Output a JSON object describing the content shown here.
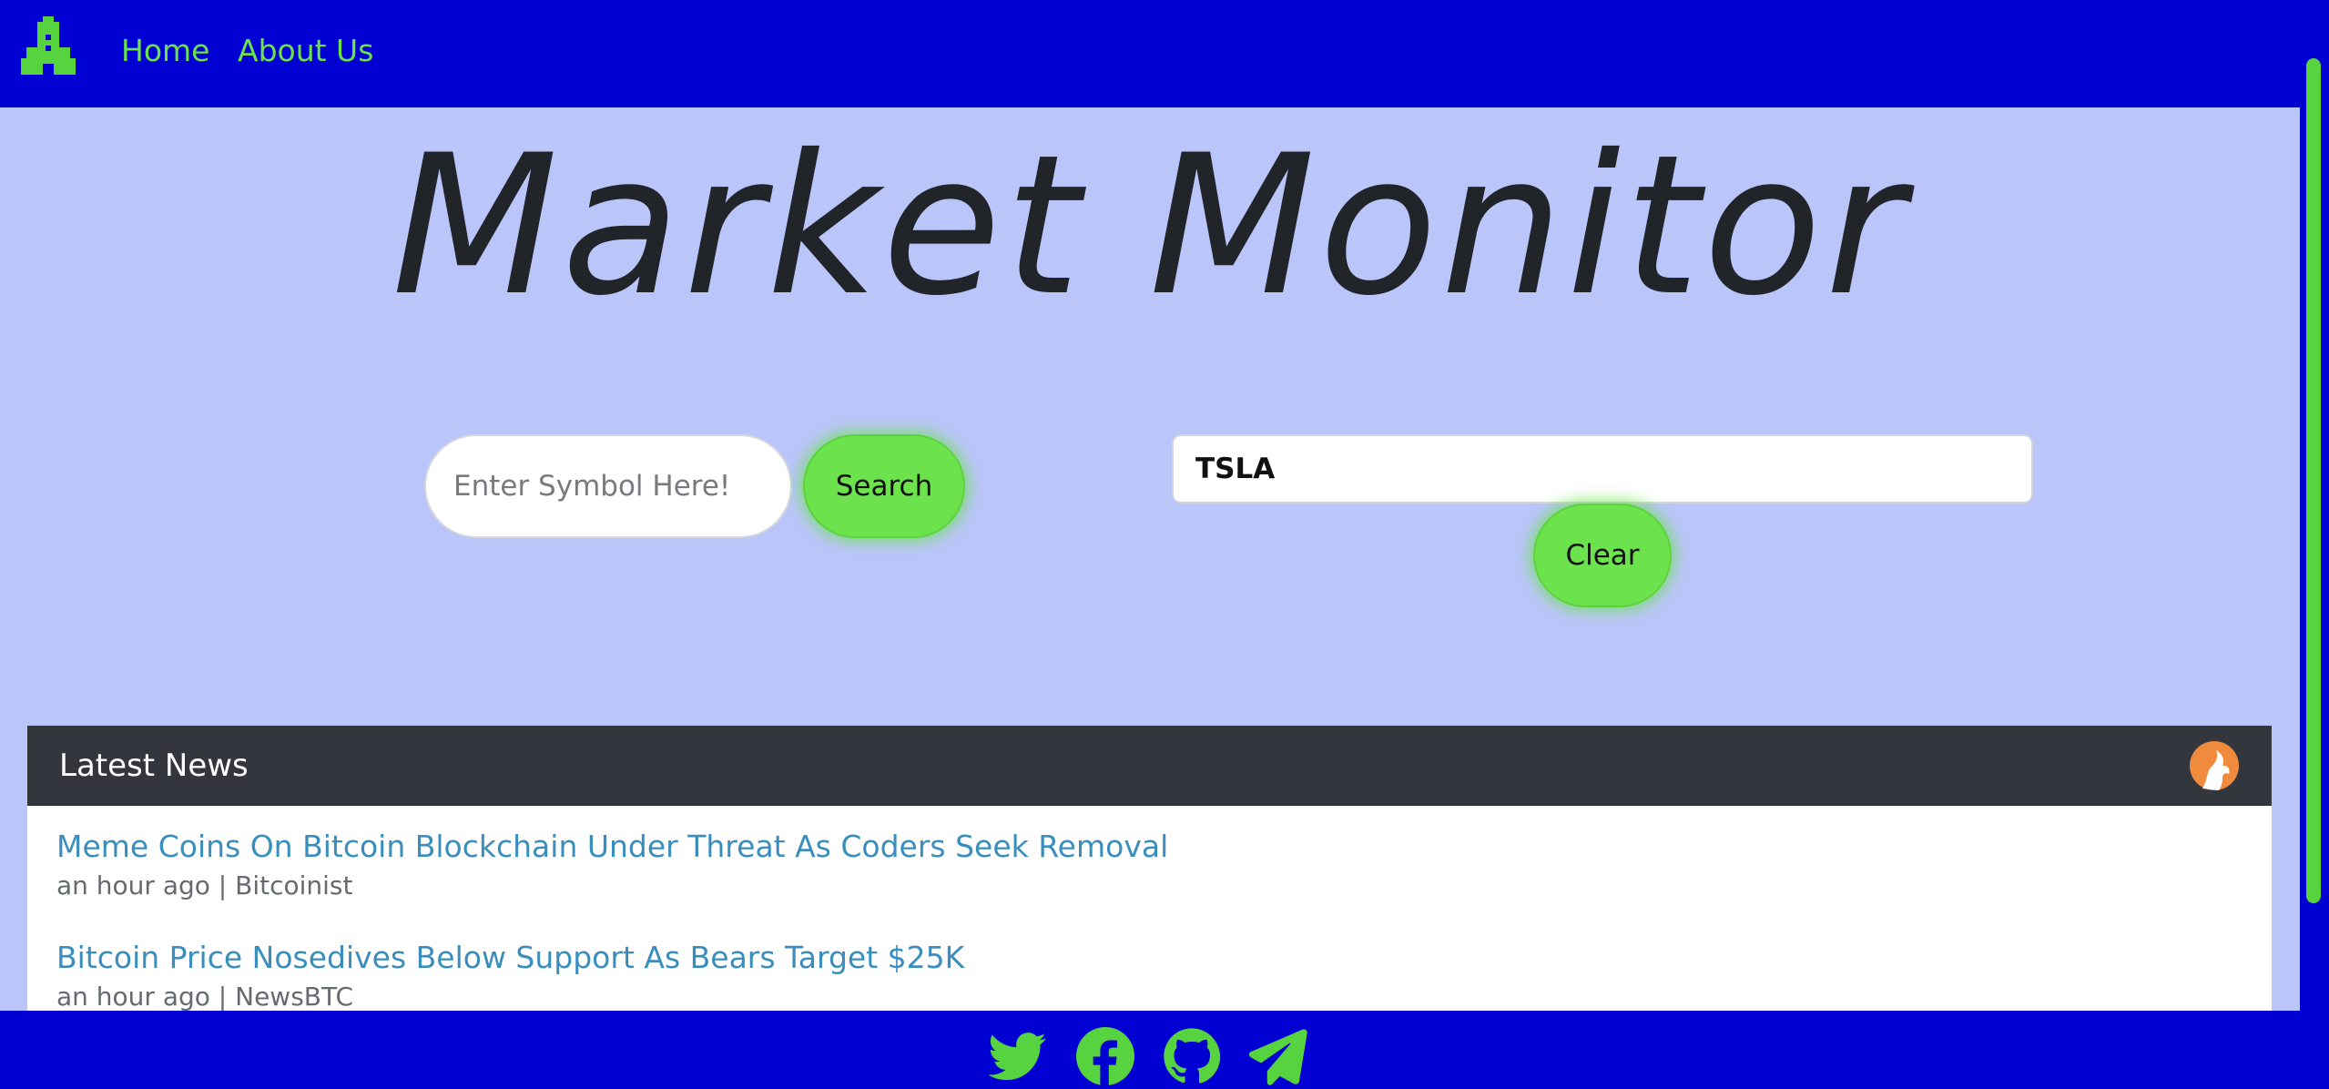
{
  "colors": {
    "navbar_background": "#0000d2",
    "page_background": "#bac5fa",
    "accent_green": "#6ce24c",
    "news_header_background": "#33363d",
    "news_link": "#3a8ebd"
  },
  "navbar": {
    "logo_icon": "pixel-rocket-icon",
    "links": [
      {
        "label": "Home"
      },
      {
        "label": "About Us"
      }
    ]
  },
  "hero": {
    "title": "Market Monitor"
  },
  "search": {
    "placeholder": "Enter Symbol Here!",
    "value": "",
    "button_label": "Search"
  },
  "ticker": {
    "value": "TSLA",
    "clear_label": "Clear"
  },
  "news": {
    "heading": "Latest News",
    "provider_icon": "provider-logo-icon",
    "items": [
      {
        "title": "Meme Coins On Bitcoin Blockchain Under Threat As Coders Seek Removal",
        "time": "an hour ago",
        "source": "Bitcoinist",
        "meta": "an hour ago | Bitcoinist"
      },
      {
        "title": "Bitcoin Price Nosedives Below Support As Bears Target $25K",
        "time": "an hour ago",
        "source": "NewsBTC",
        "meta": "an hour ago | NewsBTC"
      }
    ]
  },
  "footer": {
    "social_icons": [
      "twitter-icon",
      "facebook-icon",
      "github-icon",
      "telegram-icon"
    ]
  }
}
